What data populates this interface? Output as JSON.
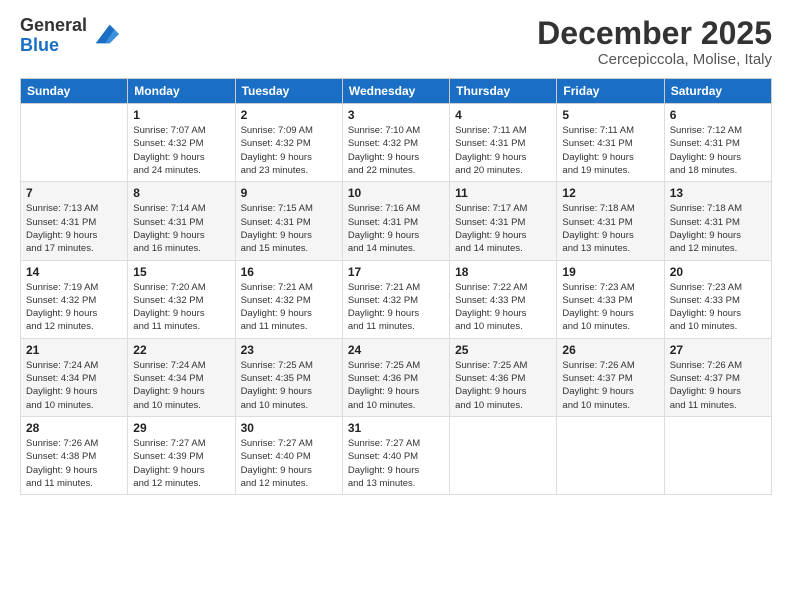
{
  "logo": {
    "general": "General",
    "blue": "Blue"
  },
  "header": {
    "month": "December 2025",
    "location": "Cercepiccola, Molise, Italy"
  },
  "weekdays": [
    "Sunday",
    "Monday",
    "Tuesday",
    "Wednesday",
    "Thursday",
    "Friday",
    "Saturday"
  ],
  "weeks": [
    [
      {
        "day": "",
        "info": ""
      },
      {
        "day": "1",
        "info": "Sunrise: 7:07 AM\nSunset: 4:32 PM\nDaylight: 9 hours\nand 24 minutes."
      },
      {
        "day": "2",
        "info": "Sunrise: 7:09 AM\nSunset: 4:32 PM\nDaylight: 9 hours\nand 23 minutes."
      },
      {
        "day": "3",
        "info": "Sunrise: 7:10 AM\nSunset: 4:32 PM\nDaylight: 9 hours\nand 22 minutes."
      },
      {
        "day": "4",
        "info": "Sunrise: 7:11 AM\nSunset: 4:31 PM\nDaylight: 9 hours\nand 20 minutes."
      },
      {
        "day": "5",
        "info": "Sunrise: 7:11 AM\nSunset: 4:31 PM\nDaylight: 9 hours\nand 19 minutes."
      },
      {
        "day": "6",
        "info": "Sunrise: 7:12 AM\nSunset: 4:31 PM\nDaylight: 9 hours\nand 18 minutes."
      }
    ],
    [
      {
        "day": "7",
        "info": "Sunrise: 7:13 AM\nSunset: 4:31 PM\nDaylight: 9 hours\nand 17 minutes."
      },
      {
        "day": "8",
        "info": "Sunrise: 7:14 AM\nSunset: 4:31 PM\nDaylight: 9 hours\nand 16 minutes."
      },
      {
        "day": "9",
        "info": "Sunrise: 7:15 AM\nSunset: 4:31 PM\nDaylight: 9 hours\nand 15 minutes."
      },
      {
        "day": "10",
        "info": "Sunrise: 7:16 AM\nSunset: 4:31 PM\nDaylight: 9 hours\nand 14 minutes."
      },
      {
        "day": "11",
        "info": "Sunrise: 7:17 AM\nSunset: 4:31 PM\nDaylight: 9 hours\nand 14 minutes."
      },
      {
        "day": "12",
        "info": "Sunrise: 7:18 AM\nSunset: 4:31 PM\nDaylight: 9 hours\nand 13 minutes."
      },
      {
        "day": "13",
        "info": "Sunrise: 7:18 AM\nSunset: 4:31 PM\nDaylight: 9 hours\nand 12 minutes."
      }
    ],
    [
      {
        "day": "14",
        "info": "Sunrise: 7:19 AM\nSunset: 4:32 PM\nDaylight: 9 hours\nand 12 minutes."
      },
      {
        "day": "15",
        "info": "Sunrise: 7:20 AM\nSunset: 4:32 PM\nDaylight: 9 hours\nand 11 minutes."
      },
      {
        "day": "16",
        "info": "Sunrise: 7:21 AM\nSunset: 4:32 PM\nDaylight: 9 hours\nand 11 minutes."
      },
      {
        "day": "17",
        "info": "Sunrise: 7:21 AM\nSunset: 4:32 PM\nDaylight: 9 hours\nand 11 minutes."
      },
      {
        "day": "18",
        "info": "Sunrise: 7:22 AM\nSunset: 4:33 PM\nDaylight: 9 hours\nand 10 minutes."
      },
      {
        "day": "19",
        "info": "Sunrise: 7:23 AM\nSunset: 4:33 PM\nDaylight: 9 hours\nand 10 minutes."
      },
      {
        "day": "20",
        "info": "Sunrise: 7:23 AM\nSunset: 4:33 PM\nDaylight: 9 hours\nand 10 minutes."
      }
    ],
    [
      {
        "day": "21",
        "info": "Sunrise: 7:24 AM\nSunset: 4:34 PM\nDaylight: 9 hours\nand 10 minutes."
      },
      {
        "day": "22",
        "info": "Sunrise: 7:24 AM\nSunset: 4:34 PM\nDaylight: 9 hours\nand 10 minutes."
      },
      {
        "day": "23",
        "info": "Sunrise: 7:25 AM\nSunset: 4:35 PM\nDaylight: 9 hours\nand 10 minutes."
      },
      {
        "day": "24",
        "info": "Sunrise: 7:25 AM\nSunset: 4:36 PM\nDaylight: 9 hours\nand 10 minutes."
      },
      {
        "day": "25",
        "info": "Sunrise: 7:25 AM\nSunset: 4:36 PM\nDaylight: 9 hours\nand 10 minutes."
      },
      {
        "day": "26",
        "info": "Sunrise: 7:26 AM\nSunset: 4:37 PM\nDaylight: 9 hours\nand 10 minutes."
      },
      {
        "day": "27",
        "info": "Sunrise: 7:26 AM\nSunset: 4:37 PM\nDaylight: 9 hours\nand 11 minutes."
      }
    ],
    [
      {
        "day": "28",
        "info": "Sunrise: 7:26 AM\nSunset: 4:38 PM\nDaylight: 9 hours\nand 11 minutes."
      },
      {
        "day": "29",
        "info": "Sunrise: 7:27 AM\nSunset: 4:39 PM\nDaylight: 9 hours\nand 12 minutes."
      },
      {
        "day": "30",
        "info": "Sunrise: 7:27 AM\nSunset: 4:40 PM\nDaylight: 9 hours\nand 12 minutes."
      },
      {
        "day": "31",
        "info": "Sunrise: 7:27 AM\nSunset: 4:40 PM\nDaylight: 9 hours\nand 13 minutes."
      },
      {
        "day": "",
        "info": ""
      },
      {
        "day": "",
        "info": ""
      },
      {
        "day": "",
        "info": ""
      }
    ]
  ]
}
